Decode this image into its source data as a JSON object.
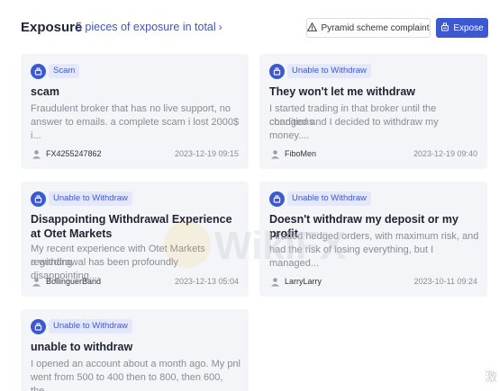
{
  "header": {
    "title": "Exposure",
    "total_link": "5 pieces of exposure in total",
    "complaint_button": "Pyramid scheme complaint",
    "expose_button": "Expose"
  },
  "watermark_text": "WikiFX",
  "corner_char": "激",
  "cards": [
    {
      "tag": "Scam",
      "title": "scam",
      "text_line1": "Fraudulent broker that has no live support, no",
      "text_line2": "answer to emails. a complete scam i lost 2000$ i...",
      "user": "FX4255247862",
      "date": "2023-12-19 09:15"
    },
    {
      "tag": "Unable to Withdraw",
      "title": "They won't let me withdraw",
      "text_line1": "I started trading in that broker until the conditions",
      "text_line2": "changed and I decided to withdraw my money....",
      "user": "FiboMen",
      "date": "2023-12-19 09:40"
    },
    {
      "tag": "Unable to Withdraw",
      "title": "Disappointing Withdrawal Experience at Otet Markets",
      "text_line1": "My recent experience with Otet Markets regarding",
      "text_line2": "a withdrawal has been profoundly disappointing....",
      "user": "BollinguerBand",
      "date": "2023-12-13 05:04"
    },
    {
      "tag": "Unable to Withdraw",
      "title": "Doesn't withdraw my deposit or my profit",
      "text_line1": "I traded hedged orders, with maximum risk, and",
      "text_line2": "had the risk of losing everything, but I managed...",
      "user": "LarryLarry",
      "date": "2023-10-11 09:24"
    },
    {
      "tag": "Unable to Withdraw",
      "title": "unable to withdraw",
      "text_line1": "I opened an account about a month ago. My pnl",
      "text_line2": "went from 500 to 400 then to 800, then 600, the..."
    }
  ]
}
